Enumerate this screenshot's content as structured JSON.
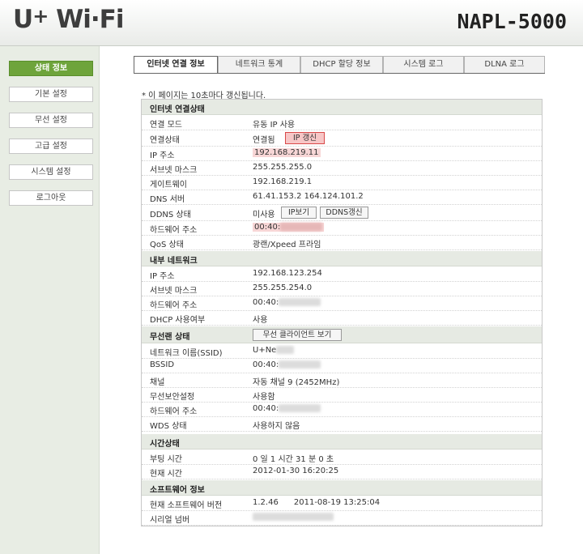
{
  "header": {
    "logo_text": "U+ Wi-Fi",
    "model": "NAPL-5000"
  },
  "sidebar": {
    "items": [
      {
        "label": "상태 정보",
        "active": true
      },
      {
        "label": "기본 설정"
      },
      {
        "label": "무선 설정"
      },
      {
        "label": "고급 설정"
      },
      {
        "label": "시스템 설정"
      },
      {
        "label": "로그아웃"
      }
    ]
  },
  "tabs": [
    {
      "label": "인터넷 연결 정보",
      "active": true
    },
    {
      "label": "네트워크 통계"
    },
    {
      "label": "DHCP 할당 정보"
    },
    {
      "label": "시스템 로그"
    },
    {
      "label": "DLNA 로그"
    }
  ],
  "notice": "* 이 페이지는 10초마다 갱신됩니다.",
  "internet": {
    "title": "인터넷 연결상태",
    "mode_label": "연결 모드",
    "mode_value": "유동 IP 사용",
    "status_label": "연결상태",
    "status_value": "연결됨",
    "renew_button": "IP 갱신",
    "ip_label": "IP 주소",
    "ip_value": "192.168.219.11",
    "mask_label": "서브넷 마스크",
    "mask_value": "255.255.255.0",
    "gw_label": "게이트웨이",
    "gw_value": "192.168.219.1",
    "dns_label": "DNS 서버",
    "dns_value": "61.41.153.2  164.124.101.2",
    "ddns_label": "DDNS 상태",
    "ddns_value": "미사용",
    "ipview_button": "IP보기",
    "ddns_button": "DDNS갱신",
    "mac_label": "하드웨어 주소",
    "mac_value": "00:40:",
    "qos_label": "QoS 상태",
    "qos_value": "광랜/Xpeed 프라임"
  },
  "internal": {
    "title": "내부 네트워크",
    "ip_label": "IP 주소",
    "ip_value": "192.168.123.254",
    "mask_label": "서브넷 마스크",
    "mask_value": "255.255.254.0",
    "mac_label": "하드웨어 주소",
    "mac_value": "00:40:",
    "dhcp_label": "DHCP 사용여부",
    "dhcp_value": "사용"
  },
  "wireless": {
    "title": "무선랜 상태",
    "clients_button": "무선 클라이언트 보기",
    "ssid_label": "네트워크 이름(SSID)",
    "ssid_value": "U+Ne",
    "bssid_label": "BSSID",
    "bssid_value": "00:40:",
    "channel_label": "채널",
    "channel_value": "자동 채널 9 (2452MHz)",
    "security_label": "무선보안설정",
    "security_value": "사용함",
    "mac_label": "하드웨어 주소",
    "mac_value": "00:40:",
    "wds_label": "WDS 상태",
    "wds_value": "사용하지 않음"
  },
  "time": {
    "title": "시간상태",
    "uptime_label": "부팅 시간",
    "uptime_value": "0 일 1 시간 31 분 0 초",
    "now_label": "현재 시간",
    "now_value": "2012-01-30 16:20:25"
  },
  "software": {
    "title": "소프트웨어 정보",
    "version_label": "현재 소프트웨어 버전",
    "version_value": "1.2.46      2011-08-19 13:25:04",
    "serial_label": "시리얼 넘버"
  }
}
